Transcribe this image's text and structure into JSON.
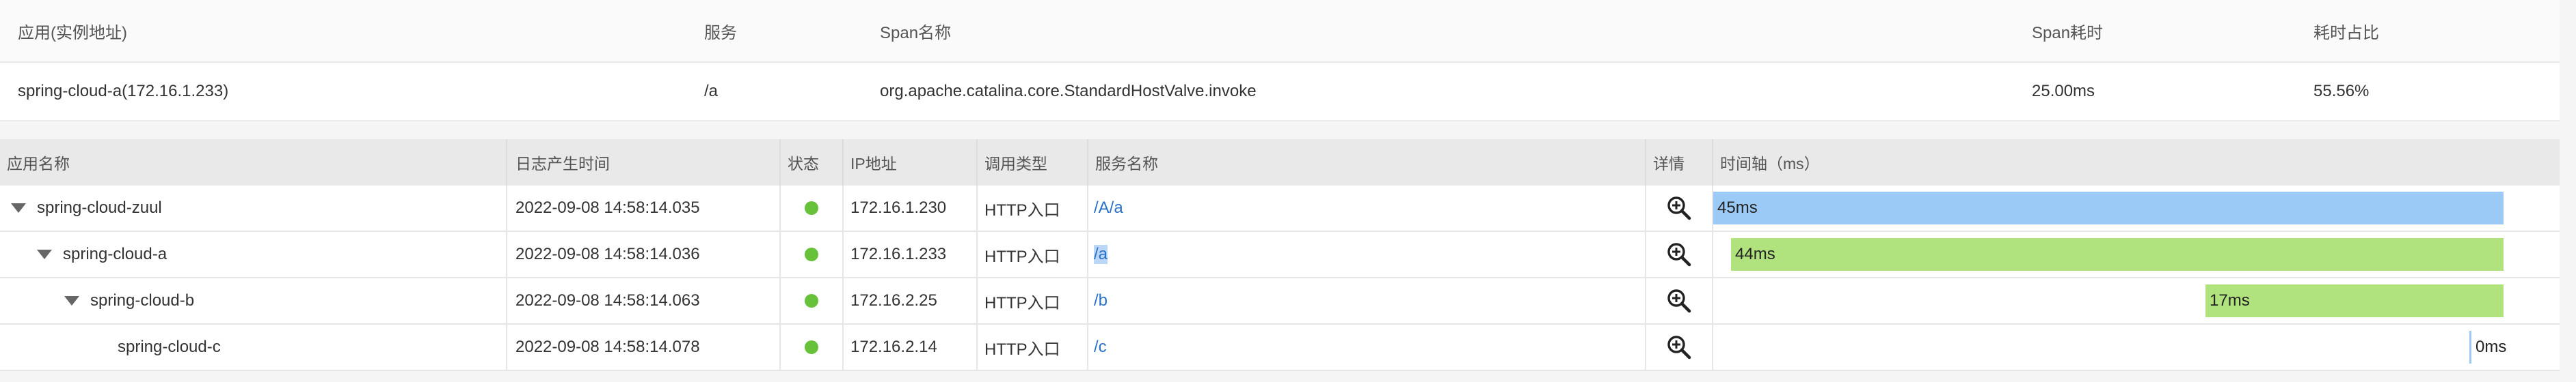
{
  "span_table": {
    "headers": {
      "app": "应用(实例地址)",
      "service": "服务",
      "span_name": "Span名称",
      "span_cost": "Span耗时",
      "cost_ratio": "耗时占比"
    },
    "row": {
      "app": "spring-cloud-a(172.16.1.233)",
      "service": "/a",
      "span_name": "org.apache.catalina.core.StandardHostValve.invoke",
      "span_cost": "25.00ms",
      "cost_ratio": "55.56%"
    }
  },
  "trace_table": {
    "headers": {
      "app_name": "应用名称",
      "log_time": "日志产生时间",
      "status": "状态",
      "ip": "IP地址",
      "call_type": "调用类型",
      "service_name": "服务名称",
      "detail": "详情",
      "timeline": "时间轴（ms）"
    },
    "rows": [
      {
        "app": "spring-cloud-zuul",
        "time": "2022-09-08 14:58:14.035",
        "status": "ok",
        "ip": "172.16.1.230",
        "call_type": "HTTP入口",
        "service": "/A/a",
        "duration": "45ms",
        "bar_color": "#9ccaf7"
      },
      {
        "app": "spring-cloud-a",
        "time": "2022-09-08 14:58:14.036",
        "status": "ok",
        "ip": "172.16.1.233",
        "call_type": "HTTP入口",
        "service": "/a",
        "duration": "44ms",
        "bar_color": "#b0e27e"
      },
      {
        "app": "spring-cloud-b",
        "time": "2022-09-08 14:58:14.063",
        "status": "ok",
        "ip": "172.16.2.25",
        "call_type": "HTTP入口",
        "service": "/b",
        "duration": "17ms",
        "bar_color": "#b0e27e"
      },
      {
        "app": "spring-cloud-c",
        "time": "2022-09-08 14:58:14.078",
        "status": "ok",
        "ip": "172.16.2.14",
        "call_type": "HTTP入口",
        "service": "/c",
        "duration": "0ms",
        "bar_color": "#9ccaf7"
      }
    ],
    "status_color": "#67c23a",
    "link_color": "#2a72c8"
  }
}
